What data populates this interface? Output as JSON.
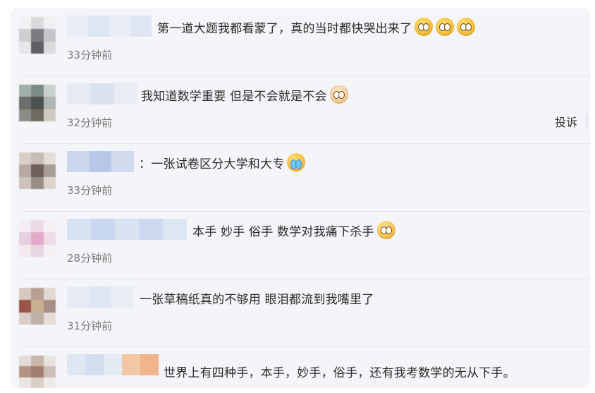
{
  "comments": [
    {
      "text": "第一道大题我都看蒙了，真的当时都快哭出来了",
      "time": "33分钟前",
      "emoji": [
        "pleading-face-icon",
        "pleading-face-icon",
        "pleading-face-icon"
      ]
    },
    {
      "text": "我知道数学重要 但是不会就是不会",
      "time": "32分钟前",
      "emoji": [
        "cat-face-icon"
      ],
      "action": "投诉"
    },
    {
      "text": "：一张试卷区分大学和大专",
      "time": "33分钟前",
      "emoji": [
        "crying-face-icon"
      ]
    },
    {
      "text": "本手 妙手 俗手 数学对我痛下杀手",
      "time": "28分钟前",
      "emoji": [
        "scared-face-icon"
      ]
    },
    {
      "text": "一张草稿纸真的不够用 眼泪都流到我嘴里了",
      "time": "31分钟前",
      "emoji": []
    },
    {
      "text": "世界上有四种手，本手，妙手，俗手，还有我考数学的无从下手。",
      "time": "",
      "emoji": []
    }
  ],
  "colors": {
    "panel": "#f4f5f8",
    "text": "#2b2b2b",
    "time": "#7a7a7a"
  }
}
